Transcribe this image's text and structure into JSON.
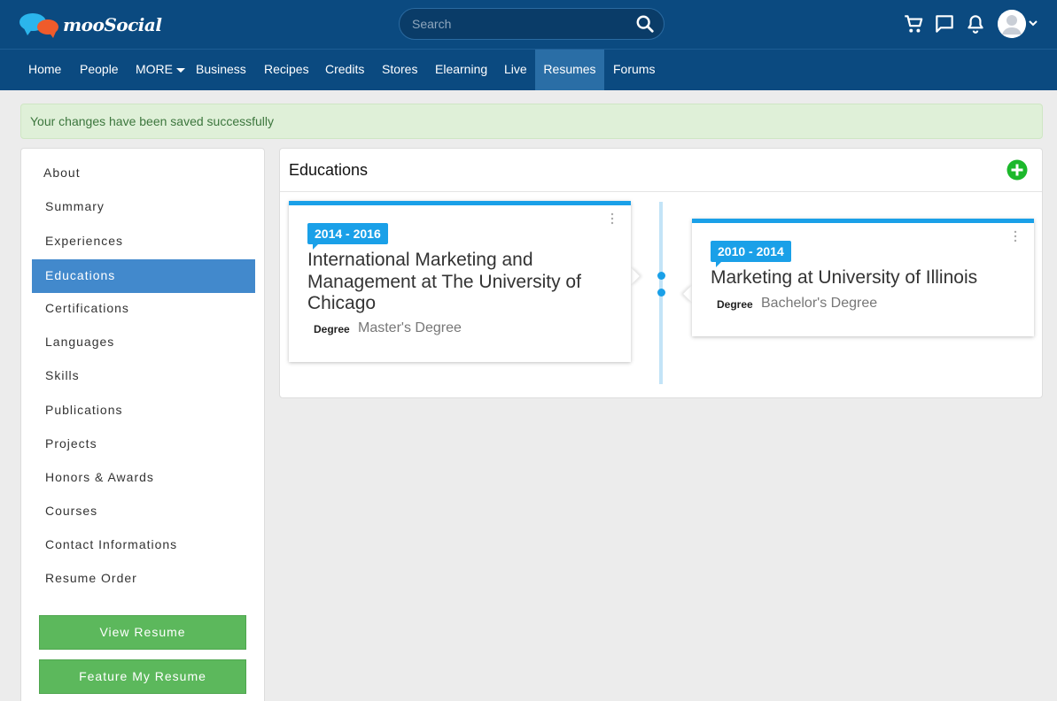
{
  "header": {
    "logo_text": "mooSocial",
    "search_placeholder": "Search"
  },
  "nav": {
    "items": [
      "Home",
      "People",
      "MORE",
      "Business",
      "Recipes",
      "Credits",
      "Stores",
      "Elearning",
      "Live",
      "Resumes",
      "Forums"
    ],
    "active": "Resumes"
  },
  "alert": {
    "message": "Your changes have been saved successfully"
  },
  "sidebar": {
    "items": [
      "About",
      "Summary",
      "Experiences",
      "Educations",
      "Certifications",
      "Languages",
      "Skills",
      "Publications",
      "Projects",
      "Honors & Awards",
      "Courses",
      "Contact Informations",
      "Resume Order"
    ],
    "active": "Educations",
    "buttons": [
      "View Resume",
      "Feature My Resume"
    ]
  },
  "main": {
    "title": "Educations",
    "educations": [
      {
        "dates": "2014 - 2016",
        "title": "International Marketing and Management at The University of Chicago",
        "degree_label": "Degree",
        "degree_value": "Master's Degree"
      },
      {
        "dates": "2010 - 2014",
        "title": "Marketing at University of Illinois",
        "degree_label": "Degree",
        "degree_value": "Bachelor's Degree"
      }
    ]
  },
  "colors": {
    "header_bg": "#0b4a80",
    "accent": "#1aa0e8",
    "active_sidebar": "#4289cc",
    "button_green": "#5cb85c",
    "alert_bg": "#dff0d8"
  },
  "icons": [
    "search-icon",
    "cart-icon",
    "chat-icon",
    "bell-icon",
    "avatar-icon",
    "chevron-down-icon",
    "plus-circle-icon",
    "more-vertical-icon"
  ]
}
